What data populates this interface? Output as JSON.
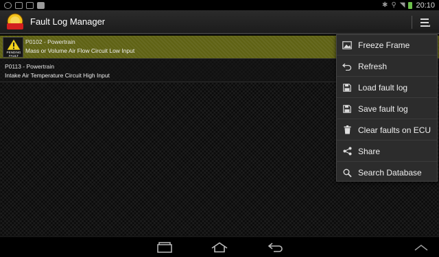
{
  "status_bar": {
    "time": "20:10",
    "left_icons": [
      "location-icon",
      "image-icon",
      "gmail-icon",
      "youtube-icon"
    ],
    "right_icons": [
      "bluetooth-icon",
      "usb-icon",
      "wifi-icon",
      "battery-icon"
    ]
  },
  "action_bar": {
    "title": "Fault Log Manager",
    "logo_text": "OBD CHECK"
  },
  "faults": [
    {
      "code": "P0102 - Powertrain",
      "description": "Mass or Volume Air Flow Circuit Low Input",
      "status": "PENDING FAULT",
      "highlight": "#5f6214"
    },
    {
      "code": "P0113 - Powertrain",
      "description": "Intake Air Temperature Circuit High Input"
    }
  ],
  "menu": {
    "items": [
      {
        "label": "Freeze Frame",
        "icon": "image-icon"
      },
      {
        "label": "Refresh",
        "icon": "undo-icon"
      },
      {
        "label": "Load fault log",
        "icon": "save-icon"
      },
      {
        "label": "Save fault log",
        "icon": "save-icon"
      },
      {
        "label": "Clear faults on ECU",
        "icon": "trash-icon"
      },
      {
        "label": "Share",
        "icon": "share-icon"
      },
      {
        "label": "Search Database",
        "icon": "search-icon"
      }
    ]
  },
  "nav_bar": {
    "buttons": [
      "recent-apps-icon",
      "home-icon",
      "back-icon",
      "chevron-up-icon"
    ]
  },
  "colors": {
    "pending_row": "#5f6214",
    "menu_bg": "#2c2c2c",
    "accent_battery": "#6cc04a"
  }
}
